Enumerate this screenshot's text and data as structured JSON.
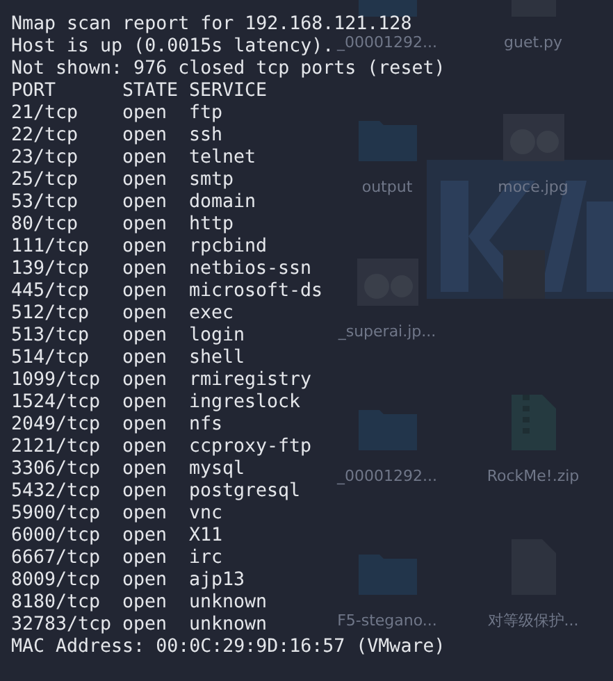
{
  "desktop_icons": [
    {
      "label": "_00001292...",
      "kind": "folder"
    },
    {
      "label": "guet.py",
      "kind": "file"
    },
    {
      "label": "output",
      "kind": "folder"
    },
    {
      "label": "moce.jpg",
      "kind": "picture"
    },
    {
      "label": "_superai.jp...",
      "kind": "picture"
    },
    {
      "kind": "none"
    },
    {
      "label": "_00001292...",
      "kind": "folder"
    },
    {
      "label": "RockMe!.zip",
      "kind": "zip"
    },
    {
      "label": "F5-stegano...",
      "kind": "folder"
    },
    {
      "label": "对等级保护...",
      "kind": "file"
    }
  ],
  "terminal": {
    "lines": [
      "Nmap scan report for 192.168.121.128",
      "Host is up (0.0015s latency).",
      "Not shown: 976 closed tcp ports (reset)"
    ],
    "columns": [
      "PORT",
      "STATE",
      "SERVICE"
    ],
    "ports": [
      {
        "port": "21/tcp",
        "state": "open",
        "service": "ftp"
      },
      {
        "port": "22/tcp",
        "state": "open",
        "service": "ssh"
      },
      {
        "port": "23/tcp",
        "state": "open",
        "service": "telnet"
      },
      {
        "port": "25/tcp",
        "state": "open",
        "service": "smtp"
      },
      {
        "port": "53/tcp",
        "state": "open",
        "service": "domain"
      },
      {
        "port": "80/tcp",
        "state": "open",
        "service": "http"
      },
      {
        "port": "111/tcp",
        "state": "open",
        "service": "rpcbind"
      },
      {
        "port": "139/tcp",
        "state": "open",
        "service": "netbios-ssn"
      },
      {
        "port": "445/tcp",
        "state": "open",
        "service": "microsoft-ds"
      },
      {
        "port": "512/tcp",
        "state": "open",
        "service": "exec"
      },
      {
        "port": "513/tcp",
        "state": "open",
        "service": "login"
      },
      {
        "port": "514/tcp",
        "state": "open",
        "service": "shell"
      },
      {
        "port": "1099/tcp",
        "state": "open",
        "service": "rmiregistry"
      },
      {
        "port": "1524/tcp",
        "state": "open",
        "service": "ingreslock"
      },
      {
        "port": "2049/tcp",
        "state": "open",
        "service": "nfs"
      },
      {
        "port": "2121/tcp",
        "state": "open",
        "service": "ccproxy-ftp"
      },
      {
        "port": "3306/tcp",
        "state": "open",
        "service": "mysql"
      },
      {
        "port": "5432/tcp",
        "state": "open",
        "service": "postgresql"
      },
      {
        "port": "5900/tcp",
        "state": "open",
        "service": "vnc"
      },
      {
        "port": "6000/tcp",
        "state": "open",
        "service": "X11"
      },
      {
        "port": "6667/tcp",
        "state": "open",
        "service": "irc"
      },
      {
        "port": "8009/tcp",
        "state": "open",
        "service": "ajp13"
      },
      {
        "port": "8180/tcp",
        "state": "open",
        "service": "unknown"
      },
      {
        "port": "32783/tcp",
        "state": "open",
        "service": "unknown"
      }
    ],
    "mac": "MAC Address: 00:0C:29:9D:16:57 (VMware)"
  }
}
